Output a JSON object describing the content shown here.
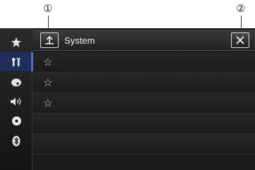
{
  "callouts": [
    "①",
    "②"
  ],
  "header": {
    "title": "System"
  },
  "sidebar": {
    "items": [
      {
        "icon": "star-icon"
      },
      {
        "icon": "settings-tools-icon",
        "active": true
      },
      {
        "icon": "theme-palette-icon"
      },
      {
        "icon": "speaker-audio-icon"
      },
      {
        "icon": "disc-icon"
      },
      {
        "icon": "bluetooth-icon"
      }
    ]
  },
  "list": {
    "rows": [
      {
        "star": "☆"
      },
      {
        "star": "☆"
      },
      {
        "star": "☆"
      },
      {
        "star": ""
      },
      {
        "star": ""
      }
    ]
  },
  "colors": {
    "active_tab": "#1f2f5a",
    "active_indicator": "#4a6fd0"
  }
}
